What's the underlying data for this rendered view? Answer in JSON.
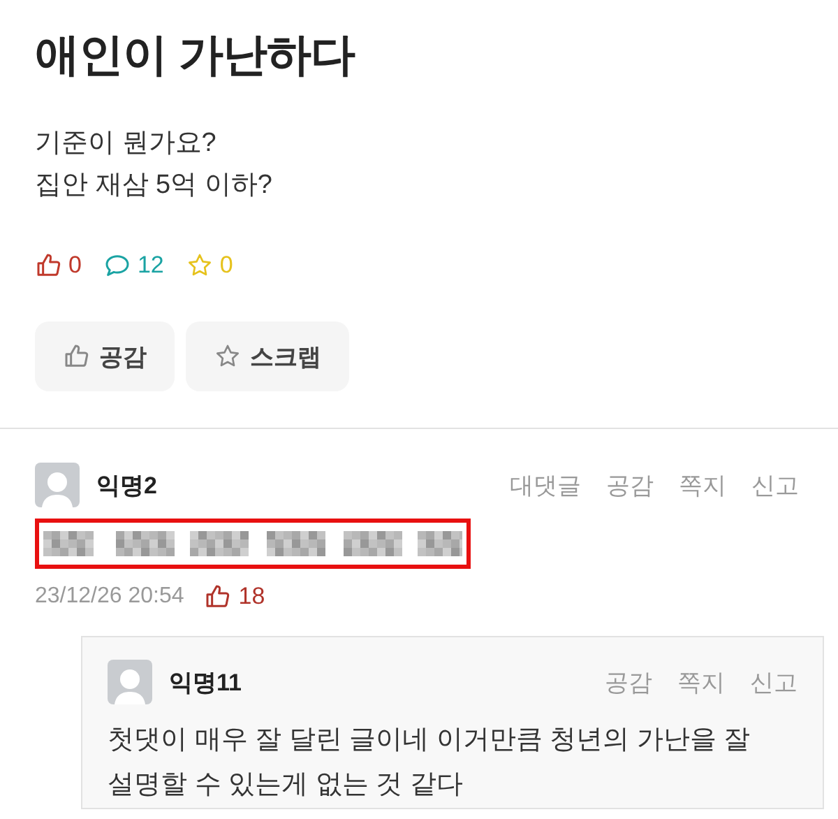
{
  "post": {
    "title": "애인이 가난하다",
    "body": [
      "기준이 뭔가요?",
      "집안 재삼 5억 이하?"
    ],
    "stats": [
      {
        "kind": "like",
        "count": "0"
      },
      {
        "kind": "comment",
        "count": "12"
      },
      {
        "kind": "scrap",
        "count": "0"
      }
    ],
    "buttons": [
      {
        "kind": "like",
        "label": "공감"
      },
      {
        "kind": "scrap",
        "label": "스크랩"
      }
    ]
  },
  "comments": [
    {
      "author": "익명2",
      "actions": [
        "대댓글",
        "공감",
        "쪽지",
        "신고"
      ],
      "content_hidden": true,
      "highlighted": true,
      "time": "23/12/26 20:54",
      "likes": "18",
      "replies": [
        {
          "author": "익명11",
          "actions": [
            "공감",
            "쪽지",
            "신고"
          ],
          "text": "첫댓이 매우 잘 달린 글이네 이거만큼 청년의 가난을 잘 설명할 수 있는게 없는 것 같다"
        }
      ]
    }
  ]
}
